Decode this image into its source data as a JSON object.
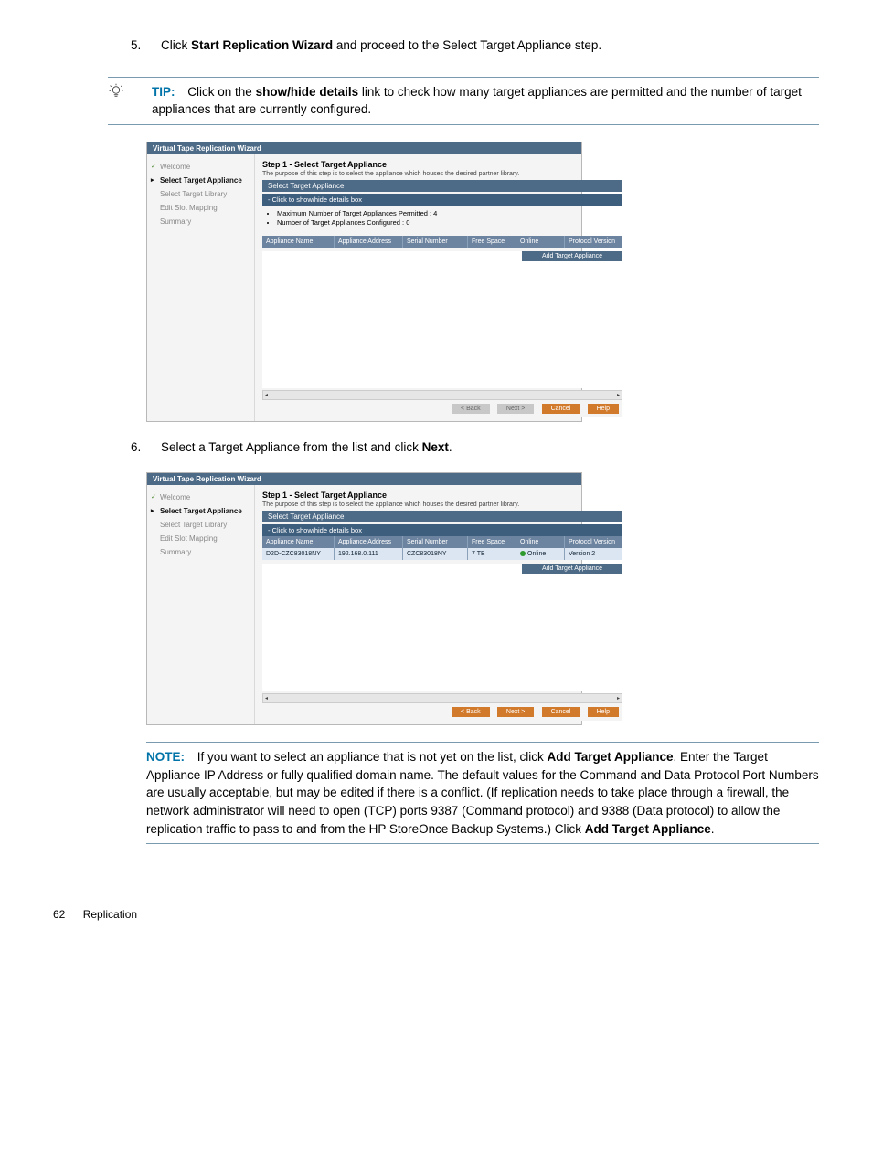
{
  "step5": {
    "num": "5.",
    "pre": "Click ",
    "strong": "Start Replication Wizard",
    "post": " and proceed to the Select Target Appliance step."
  },
  "tip": {
    "label": "TIP:",
    "pre": "Click on the ",
    "strong": "show/hide details",
    "post": " link to check how many target appliances are permitted and the number of target appliances that are currently configured."
  },
  "wizard_common": {
    "title": "Virtual Tape Replication Wizard",
    "nav": {
      "welcome": "Welcome",
      "select_target_appliance": "Select Target Appliance",
      "select_target_library": "Select Target Library",
      "edit_slot_mapping": "Edit Slot Mapping",
      "summary": "Summary"
    },
    "step_title": "Step 1 - Select Target Appliance",
    "step_sub": "The purpose of this step is to select the appliance which houses the desired partner library.",
    "section_head": "Select Target Appliance",
    "section_sub": "- Click to show/hide details box",
    "detail1": "Maximum Number of Target Appliances Permitted : 4",
    "detail2": "Number of Target Appliances Configured : 0",
    "cols": {
      "c1": "Appliance Name",
      "c2": "Appliance Address",
      "c3": "Serial Number",
      "c4": "Free Space",
      "c5": "Online",
      "c6": "Protocol Version"
    },
    "cols2": {
      "c1": "Appliance Name",
      "c2": "Appliance Address",
      "c3": "Serial Number",
      "c4": "Free Space",
      "c5": "Online",
      "c6": "Protocol Version"
    },
    "add_btn": "Add Target Appliance",
    "buttons": {
      "back": "< Back",
      "next": "Next >",
      "cancel": "Cancel",
      "help": "Help"
    }
  },
  "wizard2_row": {
    "name": "D2D-CZC83018NY",
    "addr": "192.168.0.111",
    "serial": "CZC83018NY",
    "free": "7 TB",
    "online": "Online",
    "proto": "Version 2"
  },
  "step6": {
    "num": "6.",
    "pre": "Select a Target Appliance from the list and click ",
    "strong": "Next",
    "post": "."
  },
  "note": {
    "label": "NOTE:",
    "pre": "If you want to select an appliance that is not yet on the list, click ",
    "strong1": "Add Target Appliance",
    "mid": ". Enter the Target Appliance IP Address or fully qualified domain name. The default values for the Command and Data Protocol Port Numbers are usually acceptable, but may be edited if there is a conflict. (If replication needs to take place through a firewall, the network administrator will need to open (TCP) ports 9387 (Command protocol) and 9388 (Data protocol) to allow the replication traffic to pass to and from the HP StoreOnce Backup Systems.) Click ",
    "strong2": "Add Target Appliance",
    "post2": "."
  },
  "footer": {
    "page": "62",
    "section": "Replication"
  }
}
